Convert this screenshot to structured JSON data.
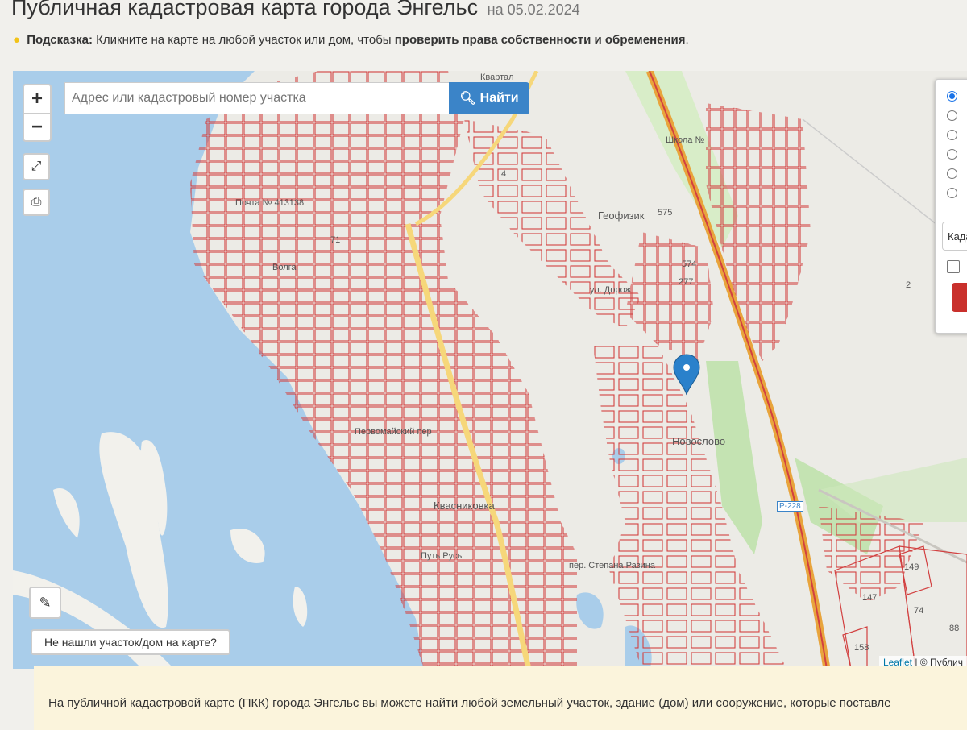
{
  "header": {
    "title": "Публичная кадастровая карта города Энгельс",
    "date": "на 05.02.2024"
  },
  "hint": {
    "label": "Подсказка:",
    "text": "Кликните на карте на любой участок или дом, чтобы",
    "bold": "проверить права собственности и обременения",
    "end": "."
  },
  "map": {
    "search_placeholder": "Адрес или кадастровый номер участка",
    "search_button": "Найти",
    "zoom_in": "+",
    "zoom_out": "−",
    "not_found_button": "Не нашли участок/дом на карте?",
    "attribution_leaflet": "Leaflet",
    "attribution_rest": "| © Публич",
    "labels": {
      "geofizik": "Геофизик",
      "novoslovo": "Новослово",
      "krasnikovka": "Квасниковка",
      "pochta": "Почта № 413138",
      "volga": "Волга",
      "shkola": "Школа №",
      "n71": "71",
      "n575": "575",
      "n574": "574",
      "n277": "277",
      "n2": "2",
      "n149": "149",
      "n147": "147",
      "n74": "74",
      "n88": "88",
      "n158": "158",
      "n4": "4",
      "ul_dorog": "ул. Дорож",
      "per_step": "пер. Степана Разина",
      "r228": "Р-228",
      "pervomay": "Первомайский пер",
      "kvartal": "Квартал",
      "put": "Путь Русь"
    },
    "accent": "#3b84c8",
    "parcel_color": "#d24040"
  },
  "side_panel": {
    "select_label": "Када"
  },
  "footer": {
    "text": "На публичной кадастровой карте (ПКК) города Энгельс вы можете найти любой земельный участок, здание (дом) или сооружение, которые поставле"
  }
}
